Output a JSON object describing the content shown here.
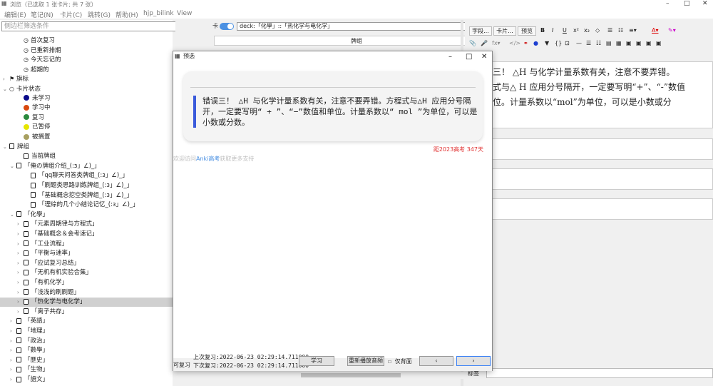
{
  "window": {
    "title": "浏览（已选取 1 张卡片; 共 7 张）",
    "minimize": "–",
    "maximize": "□",
    "close": "✕"
  },
  "menu": [
    "编辑(E)",
    "笔记(N)",
    "卡片(C)",
    "跳转(G)",
    "帮助(H)",
    "hjp_bilink",
    "View"
  ],
  "sidebar": {
    "search_placeholder": "侧边栏筛选条件",
    "items": [
      {
        "label": "首次复习",
        "indent": 2,
        "icon": "clock"
      },
      {
        "label": "已重新排期",
        "indent": 2,
        "icon": "clock"
      },
      {
        "label": "今天忘记的",
        "indent": 2,
        "icon": "clock"
      },
      {
        "label": "超期的",
        "indent": 2,
        "icon": "clock"
      },
      {
        "label": "旗标",
        "indent": 0,
        "icon": "flag",
        "arrow": "›"
      },
      {
        "label": "卡片状态",
        "indent": 0,
        "icon": "circle",
        "arrow": "⌄"
      },
      {
        "label": "未学习",
        "indent": 2,
        "dot": "#0b0b8a"
      },
      {
        "label": "学习中",
        "indent": 2,
        "dot": "#d9480f"
      },
      {
        "label": "复习",
        "indent": 2,
        "dot": "#2b8a3e"
      },
      {
        "label": "已暂停",
        "indent": 2,
        "dot": "#e6e600"
      },
      {
        "label": "被搁置",
        "indent": 2,
        "dot": "#a8a060"
      },
      {
        "label": "牌组",
        "indent": 0,
        "icon": "deck",
        "arrow": "⌄"
      },
      {
        "label": "当前牌组",
        "indent": 2,
        "icon": "deck2"
      },
      {
        "label": "「俺の牌组介绍_(:з」∠)_」",
        "indent": 1,
        "icon": "deck",
        "arrow": "⌄"
      },
      {
        "label": "「qq聊天问答类牌组_(:з」∠)_」",
        "indent": 3,
        "icon": "deck"
      },
      {
        "label": "「刷题类思路训练牌组_(:з」∠)_」",
        "indent": 3,
        "icon": "deck"
      },
      {
        "label": "「基础概念挖空类牌组_(:з」∠)_」",
        "indent": 3,
        "icon": "deck"
      },
      {
        "label": "「理综的几个小结论记忆_(:з」∠)_」",
        "indent": 3,
        "icon": "deck"
      },
      {
        "label": "「化學」",
        "indent": 1,
        "icon": "deck",
        "arrow": "⌄"
      },
      {
        "label": "「元素周期律与方程式」",
        "indent": 2,
        "icon": "deck",
        "arrow": "›"
      },
      {
        "label": "「基础概念＆会考速记」",
        "indent": 2,
        "icon": "deck",
        "arrow": "›"
      },
      {
        "label": "「工业流程」",
        "indent": 2,
        "icon": "deck",
        "arrow": "›"
      },
      {
        "label": "「平衡与速率」",
        "indent": 2,
        "icon": "deck",
        "arrow": "›"
      },
      {
        "label": "「应试复习总结」",
        "indent": 2,
        "icon": "deck",
        "arrow": "›"
      },
      {
        "label": "「无机有机实验合集」",
        "indent": 2,
        "icon": "deck",
        "arrow": "›"
      },
      {
        "label": "「有机化学」",
        "indent": 2,
        "icon": "deck",
        "arrow": "›"
      },
      {
        "label": "「浅浅的刷刷题」",
        "indent": 2,
        "icon": "deck",
        "arrow": "›"
      },
      {
        "label": "「热化学与电化学」",
        "indent": 2,
        "icon": "deck",
        "arrow": "›",
        "selected": true
      },
      {
        "label": "「离子共存」",
        "indent": 2,
        "icon": "deck",
        "arrow": "›"
      },
      {
        "label": "「英語」",
        "indent": 1,
        "icon": "deck",
        "arrow": "›"
      },
      {
        "label": "「地理」",
        "indent": 1,
        "icon": "deck",
        "arrow": "›"
      },
      {
        "label": "「政治」",
        "indent": 1,
        "icon": "deck",
        "arrow": "›"
      },
      {
        "label": "「數學」",
        "indent": 1,
        "icon": "deck",
        "arrow": "›"
      },
      {
        "label": "「歷史」",
        "indent": 1,
        "icon": "deck",
        "arrow": "›"
      },
      {
        "label": "「生物」",
        "indent": 1,
        "icon": "deck",
        "arrow": "›"
      },
      {
        "label": "「語文」",
        "indent": 1,
        "icon": "deck",
        "arrow": "›"
      }
    ]
  },
  "middle": {
    "toggle_label": "卡",
    "deck_select": "deck:「化學」::「热化学与电化学」",
    "column_header": "牌组"
  },
  "preview": {
    "title": "预选",
    "card_text": "错误三！ △H 与化学计量系数有关，注意不要弄错。方程式与△H 应用分号隔开，一定要写明“ + ”、“−”数值和单位。计量系数以“ mol ”为单位，可以是小数或分数。",
    "exam_note": "距2023高考 347天",
    "anki_prefix": "欢迎访问",
    "anki_link": "Anki高考",
    "anki_suffix": "获取更多支持",
    "review_label": "可复习",
    "last_review": "上次复习:2022-06-23 02:29:14.711000",
    "next_review": "下次复习:2022-06-23 02:29:14.711000",
    "study_button": "学习",
    "replay_button": "重新播放音频",
    "back_only_label": "仅背面",
    "prev_button": "‹",
    "next_button": "›"
  },
  "editor": {
    "fields_button": "字段...",
    "cards_button": "卡片...",
    "preview_button": "预览",
    "field1_lines": [
      "三！ △H 与化学计量系数有关，注意不要弄错。",
      "式与△ H 应用分号隔开，一定要写明“+”、“-”数值",
      "位。计量系数以“mol”为单位，可以是小数或分"
    ],
    "tags_label": "标签"
  },
  "colors": {
    "accent_blue": "#3b5bdb",
    "exam_red": "#e03131",
    "link_blue": "#4a90e2"
  }
}
